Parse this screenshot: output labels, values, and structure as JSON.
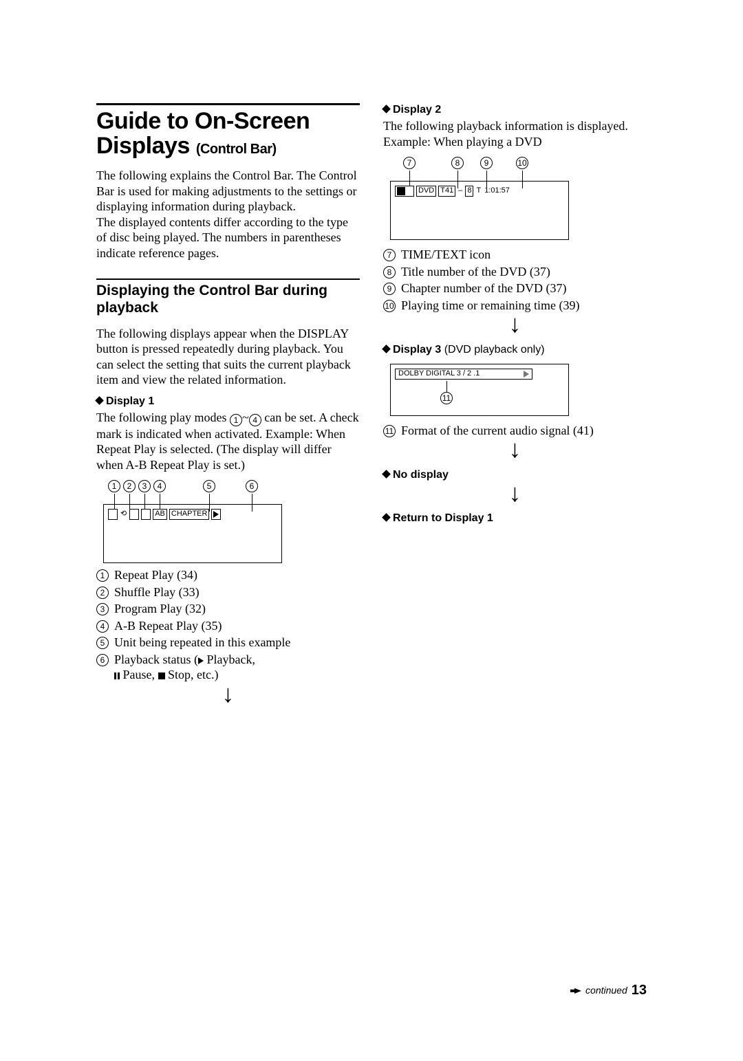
{
  "left": {
    "title_1": "Guide to On-Screen",
    "title_2": "Displays",
    "title_sub": "(Control Bar)",
    "para1": "The following explains the Control Bar. The Control Bar is used for making adjustments to the settings or displaying information during playback.",
    "para2": "The displayed contents differ according to the type of disc being played. The numbers in parentheses indicate reference pages.",
    "section_h": "Displaying the Control Bar during playback",
    "para3": "The following displays appear when the DISPLAY button is pressed repeatedly during playback. You can select the setting that suits the current playback item and view the related information.",
    "disp1_h": "Display 1",
    "disp1_p_pre": "The following play modes ",
    "disp1_p_mid": "~",
    "disp1_p_post": " can be set. A check mark is indicated when activated. Example: When Repeat Play is selected. (The display will differ when A-B Repeat Play is set.)",
    "callout_nums": [
      "1",
      "2",
      "3",
      "4",
      "5",
      "6"
    ],
    "osd1_chapter": "CHAPTER",
    "osd1_ab": "AB",
    "legend1": [
      "Repeat Play (34)",
      "Shuffle Play (33)",
      "Program Play (32)",
      "A-B Repeat Play (35)",
      "Unit being repeated in this example"
    ],
    "legend1_6a": "Playback status (",
    "legend1_6b": " Playback,",
    "legend1_6c": " Pause, ",
    "legend1_6d": " Stop, etc.)"
  },
  "right": {
    "disp2_h": "Display 2",
    "disp2_p1": "The following playback information is displayed.",
    "disp2_p2": "Example: When playing a DVD",
    "callouts2": [
      "7",
      "8",
      "9",
      "10"
    ],
    "osd2_dvd": "DVD",
    "osd2_t41": "T41",
    "osd2_dash": "–",
    "osd2_chap": "8",
    "osd2_T": "T",
    "osd2_time": "1:01:57",
    "legend2": [
      "TIME/TEXT icon",
      "Title number of the DVD (37)",
      "Chapter number of the DVD (37)",
      "Playing time or remaining time (39)"
    ],
    "disp3_h": "Display 3",
    "disp3_note": "(DVD playback only)",
    "osd3_text": "DOLBY DIGITAL   3 / 2 .1",
    "callout3": "11",
    "legend3": "Format of the current audio signal (41)",
    "nodisp_h": "No display",
    "return_h": "Return to Display 1"
  },
  "footer": {
    "continued": "continued",
    "page": "13"
  }
}
